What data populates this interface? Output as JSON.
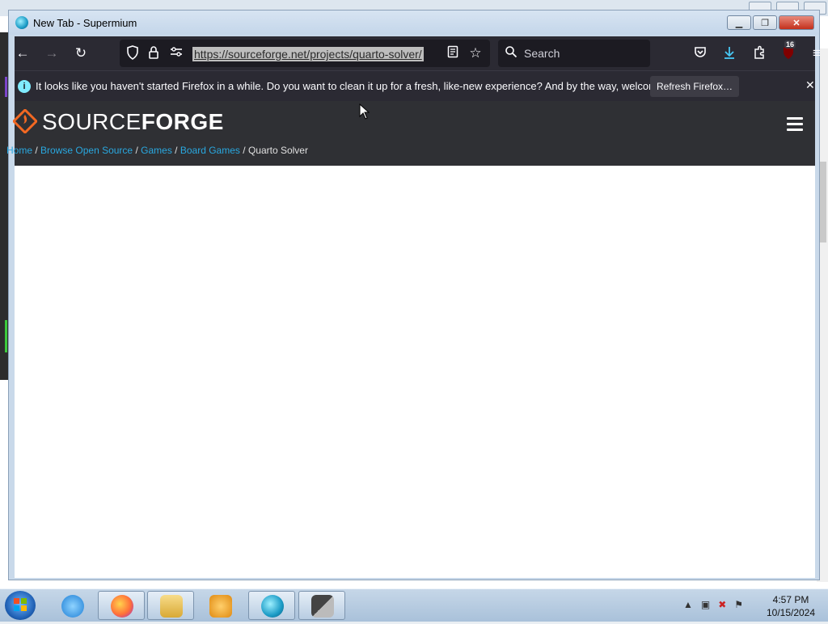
{
  "window": {
    "title": "New Tab - Supermium",
    "controls": [
      "minimize",
      "maximize",
      "close"
    ]
  },
  "toolbar": {
    "url": "https://sourceforge.net/projects/quarto-solver/",
    "search_placeholder": "Search",
    "extensions_badge": "16",
    "icons": [
      "back-icon",
      "forward-icon",
      "reload-icon",
      "shield-icon",
      "lock-icon",
      "permissions-icon",
      "reader-icon",
      "bookmark-star-icon",
      "search-icon",
      "pocket-icon",
      "download-icon",
      "extensions-icon",
      "ublock-icon",
      "menu-icon"
    ]
  },
  "notification": {
    "text": "It looks like you haven't started Firefox in a while. Do you want to clean it up for a fresh, like-new experience? And by the way, welcome back!",
    "button": "Refresh Firefox…"
  },
  "site": {
    "logo_light": "SOURCE",
    "logo_bold": "FORGE",
    "breadcrumb": {
      "home": "Home",
      "browse": "Browse Open Source",
      "games": "Games",
      "board_games": "Board Games",
      "current": "Quarto Solver",
      "separator": "/"
    },
    "colors": {
      "header_bg": "#2f3034",
      "link": "#29a8e0",
      "logo_orange": "#f26822"
    }
  },
  "taskbar": {
    "apps": [
      "internet-explorer",
      "firefox",
      "file-explorer",
      "media-player",
      "supermium",
      "game-app"
    ],
    "clock_time": "4:57 PM",
    "clock_date": "10/15/2024"
  }
}
